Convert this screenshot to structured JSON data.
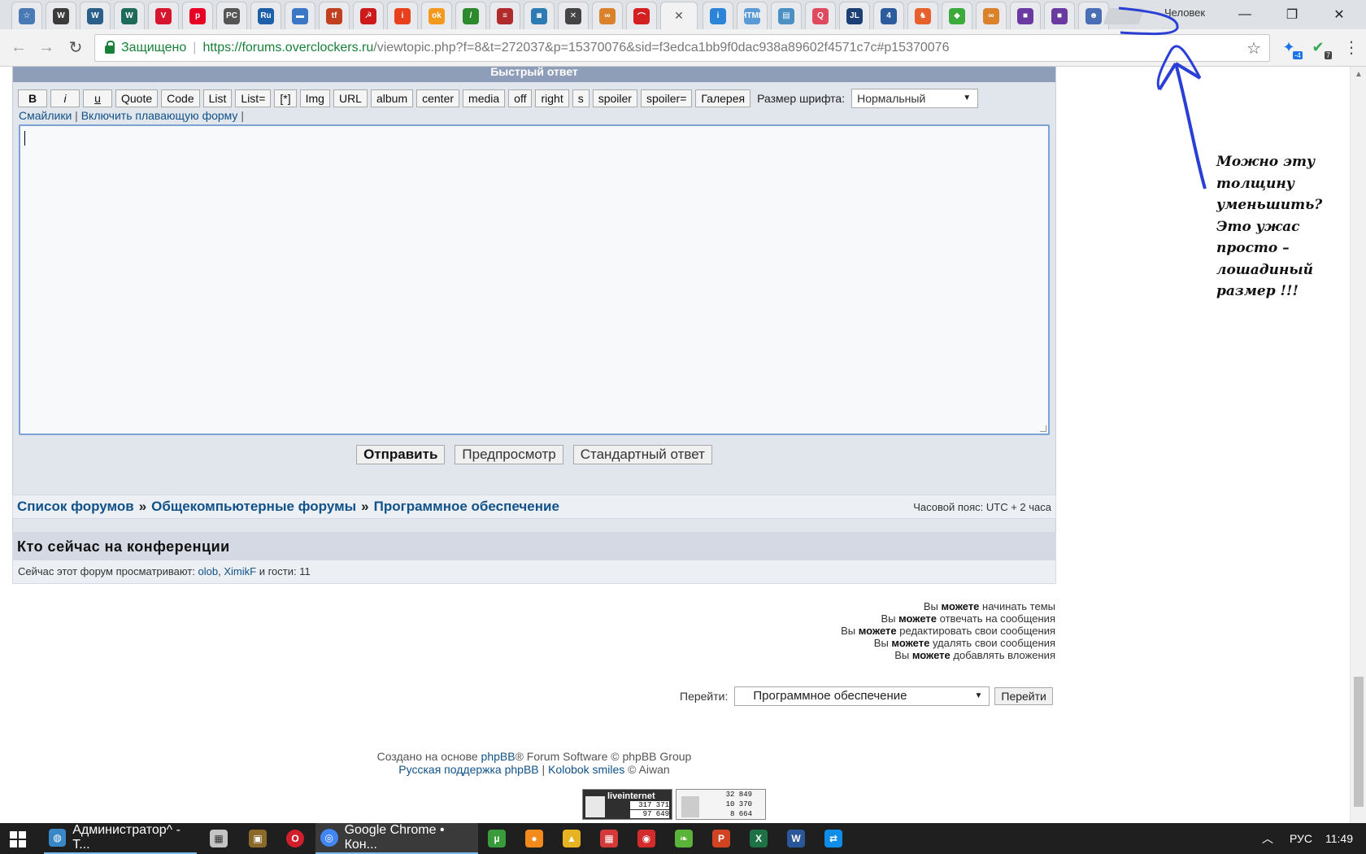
{
  "window": {
    "profile_name": "Человек",
    "minimize": "—",
    "restore": "❐",
    "close": "✕"
  },
  "tabs": [
    {
      "icon": "star",
      "color": "#4a7ab5",
      "glyph": "☆"
    },
    {
      "icon": "wot",
      "color": "#3b3b3b",
      "glyph": "W"
    },
    {
      "icon": "wows",
      "color": "#2b5f8a",
      "glyph": "W"
    },
    {
      "icon": "warships",
      "color": "#1e6b5c",
      "glyph": "W"
    },
    {
      "icon": "shield-v",
      "color": "#d8152e",
      "glyph": "V"
    },
    {
      "icon": "pinterest",
      "color": "#e60023",
      "glyph": "p"
    },
    {
      "icon": "pc",
      "color": "#555555",
      "glyph": "PC"
    },
    {
      "icon": "ru",
      "color": "#1d5fa8",
      "glyph": "Ru"
    },
    {
      "icon": "hdd",
      "color": "#3a77c4",
      "glyph": "▬"
    },
    {
      "icon": "tfile",
      "color": "#c04020",
      "glyph": "tf"
    },
    {
      "icon": "soviet",
      "color": "#cc1a1a",
      "glyph": "☭"
    },
    {
      "icon": "info-i",
      "color": "#e8401c",
      "glyph": "i"
    },
    {
      "icon": "ok",
      "color": "#f39a1e",
      "glyph": "ok"
    },
    {
      "icon": "green-stripe",
      "color": "#2d8a2d",
      "glyph": "/"
    },
    {
      "icon": "flag",
      "color": "#b02c2c",
      "glyph": "≡"
    },
    {
      "icon": "portrait",
      "color": "#2e7bb4",
      "glyph": "◙"
    },
    {
      "icon": "crossed",
      "color": "#444444",
      "glyph": "✕"
    },
    {
      "icon": "link-orange",
      "color": "#d9822b",
      "glyph": "∞"
    },
    {
      "icon": "arc-red",
      "color": "#d42020",
      "glyph": "⌒"
    },
    {
      "icon": "active-tab",
      "color": "#f2f2f2",
      "glyph": "✕",
      "active": true
    },
    {
      "icon": "info-blue",
      "color": "#2b84d8",
      "glyph": "i"
    },
    {
      "icon": "html",
      "color": "#5a9bd5",
      "glyph": "HTML"
    },
    {
      "icon": "doc",
      "color": "#4a90c2",
      "glyph": "▤"
    },
    {
      "icon": "search-red",
      "color": "#e04a5e",
      "glyph": "Q"
    },
    {
      "icon": "jl",
      "color": "#1c3f75",
      "glyph": "JL"
    },
    {
      "icon": "four",
      "color": "#2d5c9e",
      "glyph": "4"
    },
    {
      "icon": "cat",
      "color": "#e8602c",
      "glyph": "♞"
    },
    {
      "icon": "diamond",
      "color": "#3cab3c",
      "glyph": "◆"
    },
    {
      "icon": "link-orange-2",
      "color": "#d9822b",
      "glyph": "∞"
    },
    {
      "icon": "square-purple",
      "color": "#6a3aa0",
      "glyph": "■"
    },
    {
      "icon": "square-purple-2",
      "color": "#6a3aa0",
      "glyph": "■"
    },
    {
      "icon": "robot",
      "color": "#4a6fb5",
      "glyph": "☻"
    }
  ],
  "toolbar": {
    "secure_label": "Защищено",
    "url_main": "https://forums.overclockers.ru",
    "url_rest": "/viewtopic.php?f=8&t=272037&p=15370076&sid=f3edca1bb9f0dac938a89602f4571c7c#p15370076",
    "ext1_badge": "-4",
    "ext2_badge": "7"
  },
  "quick_reply": {
    "header": "Быстрый ответ",
    "bbcode_buttons": [
      "B",
      "i",
      "u",
      "Quote",
      "Code",
      "List",
      "List=",
      "[*]",
      "Img",
      "URL",
      "album",
      "center",
      "media",
      "off",
      "right",
      "s",
      "spoiler",
      "spoiler=",
      "Галерея"
    ],
    "font_size_label": "Размер шрифта:",
    "font_size_value": "Нормальный",
    "smilies_link": "Смайлики",
    "floating_form_link": "Включить плавающую форму",
    "link_separator": "|",
    "submit_label": "Отправить",
    "preview_label": "Предпросмотр",
    "standard_reply_label": "Стандартный ответ"
  },
  "breadcrumbs": {
    "items": [
      "Список форумов",
      "Общекомпьютерные форумы",
      "Программное обеспечение"
    ],
    "separator": "»",
    "timezone": "Часовой пояс: UTC + 2 часа"
  },
  "online": {
    "title": "Кто сейчас на конференции",
    "prefix": "Сейчас этот форум просматривают:",
    "user1": "olob",
    "comma": ",",
    "user2": "XimikF",
    "suffix": "и гости: 11"
  },
  "permissions": [
    {
      "pre": "Вы",
      "bold": "можете",
      "post": "начинать темы"
    },
    {
      "pre": "Вы",
      "bold": "можете",
      "post": "отвечать на сообщения"
    },
    {
      "pre": "Вы",
      "bold": "можете",
      "post": "редактировать свои сообщения"
    },
    {
      "pre": "Вы",
      "bold": "можете",
      "post": "удалять свои сообщения"
    },
    {
      "pre": "Вы",
      "bold": "можете",
      "post": "добавлять вложения"
    }
  ],
  "jump": {
    "label": "Перейти:",
    "value": "Программное обеспечение",
    "button": "Перейти"
  },
  "footer": {
    "line1_pre": "Создано на основе",
    "line1_link": "phpBB",
    "line1_post": "® Forum Software © phpBB Group",
    "line2_link1": "Русская поддержка phpBB",
    "line2_sep": "|",
    "line2_link2": "Kolobok smiles",
    "line2_post": "© Aiwan"
  },
  "counters": {
    "li_title": "liveinternet",
    "li_values": [
      "317 371",
      "97 649"
    ],
    "stat_values": [
      "32 849",
      "10 370",
      "8 664"
    ]
  },
  "annotation": {
    "lines": [
      "Можно эту",
      "толщину",
      "уменьшить?",
      "Это ужас",
      "просто –",
      "лошадиный",
      "размер !!!"
    ]
  },
  "taskbar": {
    "task1": "Администратор^ - Т...",
    "task2": "Google Chrome • Кон...",
    "lang": "РУС",
    "time": "11:49",
    "pinned": [
      {
        "icon": "utorrent",
        "color": "#3a9b3a",
        "glyph": "µ"
      },
      {
        "icon": "orange-ball",
        "color": "#f28a1c",
        "glyph": "●"
      },
      {
        "icon": "triangle",
        "color": "#e8b323",
        "glyph": "▲"
      },
      {
        "icon": "gift",
        "color": "#d43a3a",
        "glyph": "▦"
      },
      {
        "icon": "camera",
        "color": "#d42c2c",
        "glyph": "◉"
      },
      {
        "icon": "leaf",
        "color": "#5ab43a",
        "glyph": "❧"
      },
      {
        "icon": "powerpoint",
        "color": "#d04423",
        "glyph": "P"
      },
      {
        "icon": "excel",
        "color": "#1e7145",
        "glyph": "X"
      },
      {
        "icon": "word",
        "color": "#2b579a",
        "glyph": "W"
      },
      {
        "icon": "teamviewer",
        "color": "#0e8ee9",
        "glyph": "⇄"
      }
    ]
  }
}
